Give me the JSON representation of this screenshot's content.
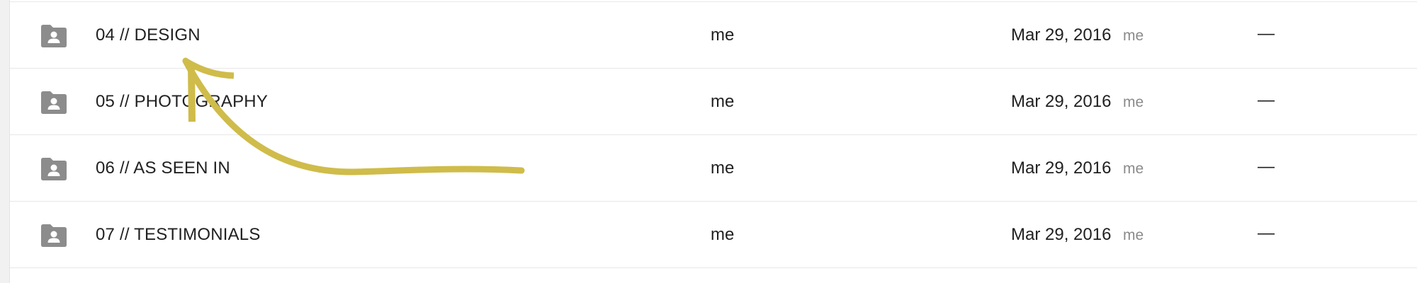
{
  "file_list": {
    "rows": [
      {
        "name": "04 // DESIGN",
        "owner": "me",
        "modified": "Mar 29, 2016",
        "modified_by": "me",
        "size": "—"
      },
      {
        "name": "05 // PHOTOGRAPHY",
        "owner": "me",
        "modified": "Mar 29, 2016",
        "modified_by": "me",
        "size": "—"
      },
      {
        "name": "06 // AS SEEN IN",
        "owner": "me",
        "modified": "Mar 29, 2016",
        "modified_by": "me",
        "size": "—"
      },
      {
        "name": "07 // TESTIMONIALS",
        "owner": "me",
        "modified": "Mar 29, 2016",
        "modified_by": "me",
        "size": "—"
      }
    ]
  },
  "icons": {
    "folder": "shared-folder-icon"
  },
  "colors": {
    "folder_icon": "#8c8c8c",
    "annotation_arrow": "#cfbc4a",
    "text_primary": "#212121",
    "text_secondary": "#8a8a8a"
  }
}
